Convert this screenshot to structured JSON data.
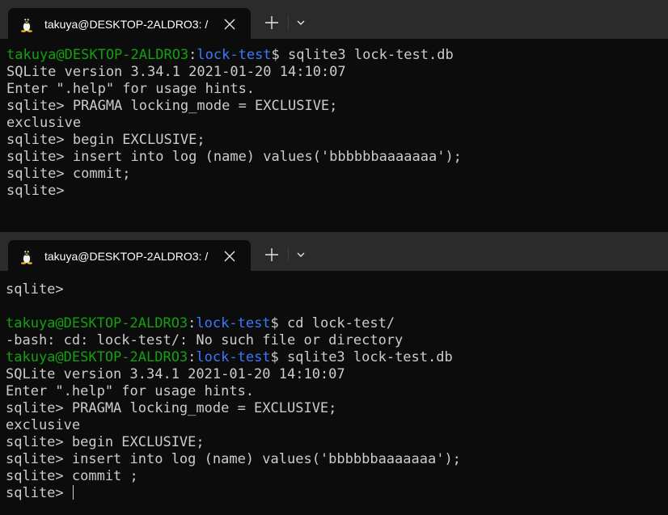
{
  "colors": {
    "background": "#0c0c0c",
    "tabbar": "#2b2b2b",
    "text": "#cccccc",
    "prompt_user": "#13a10e",
    "prompt_path": "#3b78ff"
  },
  "windows": [
    {
      "tab": {
        "icon": "linux-tux-icon",
        "title": "takuya@DESKTOP-2ALDRO3: /"
      },
      "lines": [
        {
          "type": "prompt",
          "user": "takuya@DESKTOP-2ALDRO3",
          "sep": ":",
          "path": "lock-test",
          "cmd": "$ sqlite3 lock-test.db"
        },
        {
          "type": "text",
          "text": "SQLite version 3.34.1 2021-01-20 14:10:07"
        },
        {
          "type": "text",
          "text": "Enter \".help\" for usage hints."
        },
        {
          "type": "text",
          "text": "sqlite> PRAGMA locking_mode = EXCLUSIVE;"
        },
        {
          "type": "text",
          "text": "exclusive"
        },
        {
          "type": "text",
          "text": "sqlite> begin EXCLUSIVE;"
        },
        {
          "type": "text",
          "text": "sqlite> insert into log (name) values('bbbbbbaaaaaaa');"
        },
        {
          "type": "text",
          "text": "sqlite> commit;"
        },
        {
          "type": "text",
          "text": "sqlite>"
        }
      ]
    },
    {
      "tab": {
        "icon": "linux-tux-icon",
        "title": "takuya@DESKTOP-2ALDRO3: /"
      },
      "lines": [
        {
          "type": "text",
          "text": "sqlite>"
        },
        {
          "type": "text",
          "text": ""
        },
        {
          "type": "prompt",
          "user": "takuya@DESKTOP-2ALDRO3",
          "sep": ":",
          "path": "lock-test",
          "cmd": "$ cd lock-test/"
        },
        {
          "type": "text",
          "text": "-bash: cd: lock-test/: No such file or directory"
        },
        {
          "type": "prompt",
          "user": "takuya@DESKTOP-2ALDRO3",
          "sep": ":",
          "path": "lock-test",
          "cmd": "$ sqlite3 lock-test.db"
        },
        {
          "type": "text",
          "text": "SQLite version 3.34.1 2021-01-20 14:10:07"
        },
        {
          "type": "text",
          "text": "Enter \".help\" for usage hints."
        },
        {
          "type": "text",
          "text": "sqlite> PRAGMA locking_mode = EXCLUSIVE;"
        },
        {
          "type": "text",
          "text": "exclusive"
        },
        {
          "type": "text",
          "text": "sqlite> begin EXCLUSIVE;"
        },
        {
          "type": "text",
          "text": "sqlite> insert into log (name) values('bbbbbbaaaaaaa');"
        },
        {
          "type": "text",
          "text": "sqlite> commit ;"
        },
        {
          "type": "text",
          "text": "sqlite> ",
          "cursor": true
        }
      ]
    }
  ]
}
